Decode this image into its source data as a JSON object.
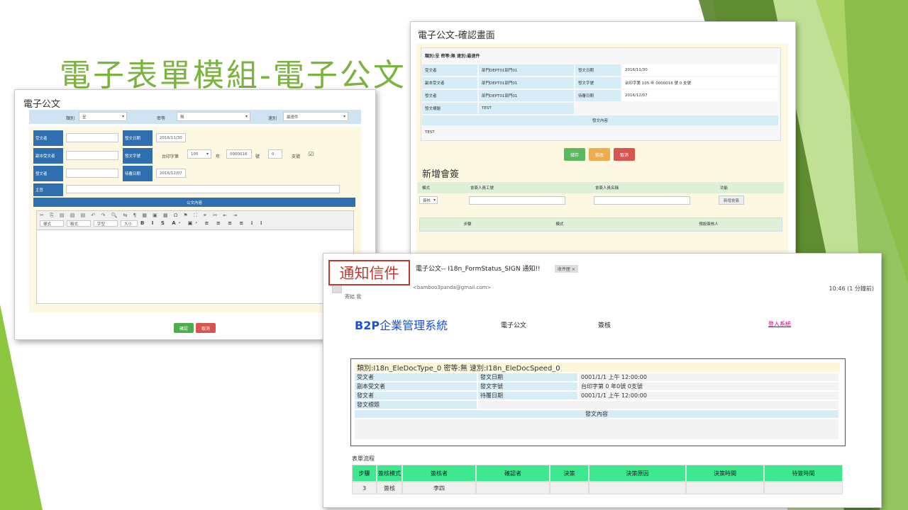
{
  "slide": {
    "title": "電子表單模組-電子公文"
  },
  "form_screenshot": {
    "title": "電子公文",
    "filters": [
      {
        "label": "類別",
        "value": "呈"
      },
      {
        "label": "密等",
        "value": "無"
      },
      {
        "label": "速別",
        "value": "最速件"
      }
    ],
    "rows": [
      {
        "label1": "受文者",
        "value1": "",
        "label2": "發文日期",
        "value2": "2016/11/30"
      },
      {
        "label1": "副本受文者",
        "value1": "",
        "label2": "發文字號",
        "value2": "台印字第"
      },
      {
        "label1": "發文者",
        "value1": "",
        "label2": "待覆日期",
        "value2": "2016/12/07"
      }
    ],
    "doc_number": {
      "year": "105",
      "word": "年",
      "number": "0000016",
      "hao": "號",
      "sub": "0",
      "zhi": "支號"
    },
    "subject_label": "主旨",
    "content_header": "公文內容",
    "toolbar_row2": [
      "樣式",
      "格式",
      "字型",
      "大小"
    ],
    "confirm_label": "確認",
    "cancel_label": "取消"
  },
  "confirm_screenshot": {
    "title": "電子公文-確認畫面",
    "summary": "類別:呈 密等:無 速別:最速件",
    "rows": [
      {
        "label1": "受文者",
        "value1": "部門DEPT01部門01",
        "label2": "發文日期",
        "value2": "2016/11/30"
      },
      {
        "label1": "副本受文者",
        "value1": "部門DEPT01部門01",
        "label2": "發文字號",
        "value2": "台印字第 105 年 0000016 號 0 支號"
      },
      {
        "label1": "發文者",
        "value1": "部門DEPT01部門01",
        "label2": "待覆日期",
        "value2": "2016/12/07"
      },
      {
        "label1": "發文標題",
        "value1": "TEST",
        "label2": "",
        "value2": ""
      }
    ],
    "content_header": "發文內容",
    "content_value": "TEST",
    "save_label": "儲存",
    "edit_label": "修改",
    "cancel_label": "取消",
    "sign_title": "新增會簽",
    "sign_headers": [
      "模式",
      "會簽人員工號",
      "會簽人員名稱",
      "功能"
    ],
    "sign_mode_value": "簽核",
    "sign_add_label": "新增會簽",
    "flow_headers": [
      "步驟",
      "模式",
      "預設簽核人"
    ]
  },
  "email_screenshot": {
    "callout": "通知信件",
    "subject": "電子公文-- I18n_FormStatus_SIGN 通知!!",
    "inbox_tag": "收件匣",
    "sender_email": "<bamboo3panda@gmail.com>",
    "to_me": "寄給 我",
    "time": "10:46 (1 分鐘前)",
    "brand_bold": "B2P",
    "brand_rest": "企業管理系統",
    "module": "電子公文",
    "action": "簽核",
    "login_link": "登入系統",
    "summary": "類別:I18n_EleDocType_0 密等:無 速別:I18n_EleDocSpeed_0",
    "rows": [
      {
        "label1": "受文者",
        "value1": "",
        "label2": "發文日期",
        "value2": "0001/1/1 上午 12:00:00"
      },
      {
        "label1": "副本受文者",
        "value1": "",
        "label2": "發文字號",
        "value2": "台印字第 0 年0號 0支號"
      },
      {
        "label1": "發文者",
        "value1": "",
        "label2": "待覆日期",
        "value2": "0001/1/1 上午 12:00:00"
      },
      {
        "label1": "發文標題",
        "value1": "",
        "label2": "",
        "value2": ""
      }
    ],
    "content_header": "發文內容",
    "flow_title": "表單流程",
    "flow_headers": [
      "步驟",
      "簽核模式",
      "簽核者",
      "確認者",
      "決策",
      "決策原因",
      "決策時間",
      "待簽時間"
    ],
    "flow_row": [
      "3",
      "簽核",
      "李四",
      "",
      "",
      "",
      "",
      ""
    ]
  },
  "colors": {
    "accent_green": "#7ab33d",
    "table_green": "#3de88f",
    "label_blue": "#2f6fb0",
    "callout_red": "#c0392b"
  }
}
